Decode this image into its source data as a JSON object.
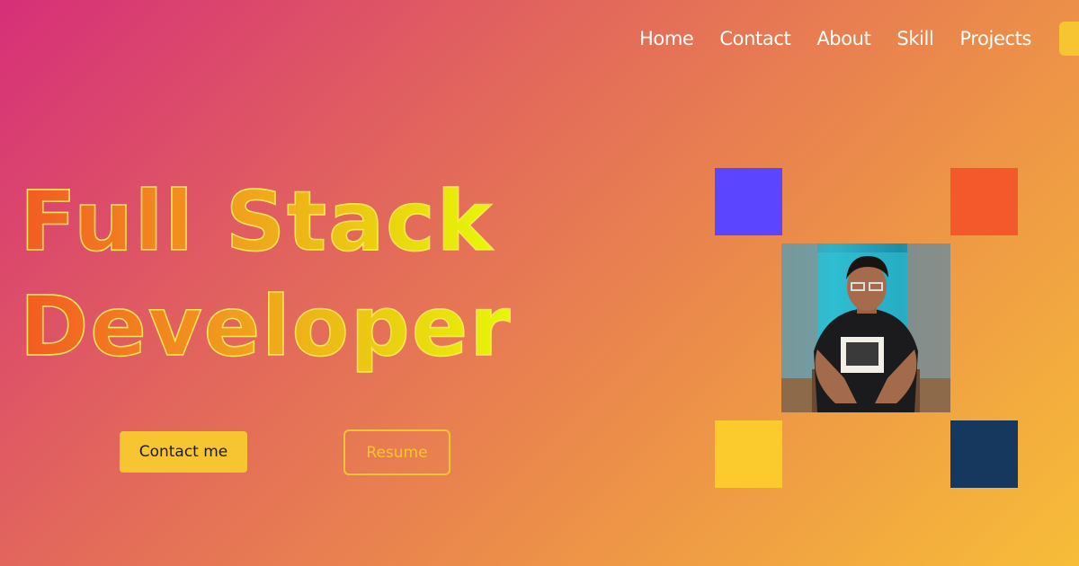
{
  "nav": {
    "items": [
      {
        "label": "Home"
      },
      {
        "label": "Contact"
      },
      {
        "label": "About"
      },
      {
        "label": "Skill"
      },
      {
        "label": "Projects"
      }
    ]
  },
  "hero": {
    "line1": "Full Stack",
    "line2": "Developer",
    "contact_button": "Contact me",
    "resume_button": "Resume"
  },
  "colors": {
    "accent": "#f6c531",
    "square_blue": "#5b45ff",
    "square_red": "#f4592c",
    "square_yellow": "#fbcb2e",
    "square_navy": "#17385e"
  },
  "image": {
    "subject": "portrait-photo"
  }
}
